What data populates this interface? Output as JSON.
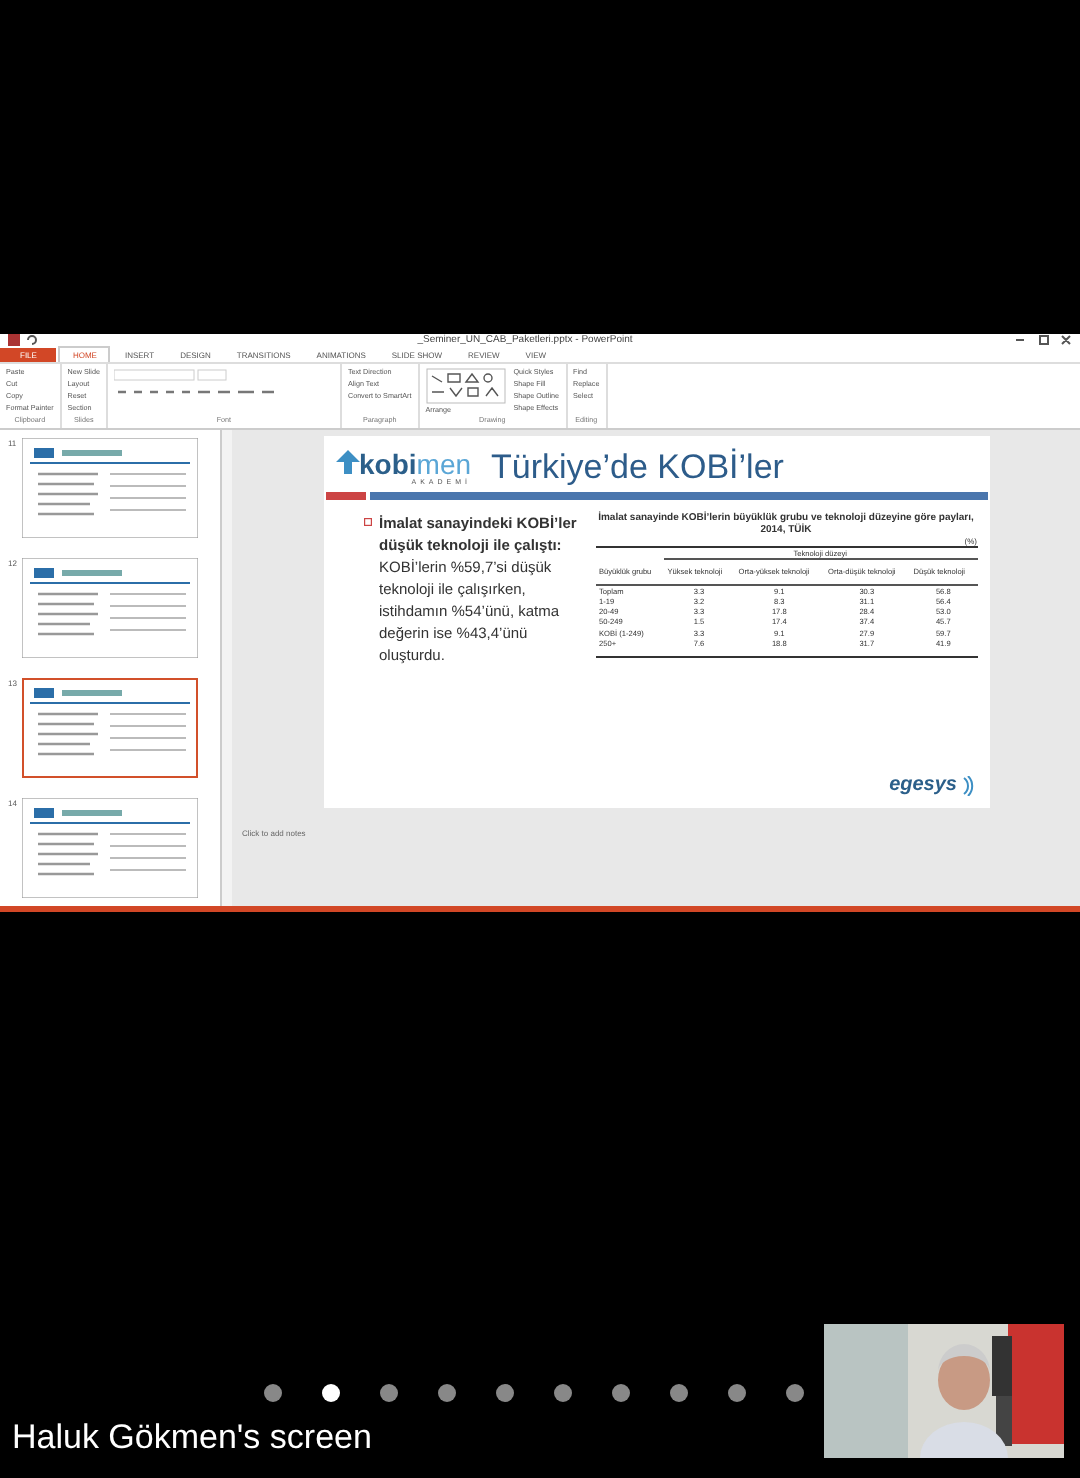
{
  "powerpoint": {
    "title": "_Seminer_UN_CAB_Paketleri.pptx - PowerPoint",
    "ribbon_tabs": [
      {
        "label": "FILE",
        "selected": false,
        "kind": "file"
      },
      {
        "label": "HOME",
        "selected": true,
        "kind": "tab"
      },
      {
        "label": "INSERT",
        "selected": false,
        "kind": "tab"
      },
      {
        "label": "DESIGN",
        "selected": false,
        "kind": "tab"
      },
      {
        "label": "TRANSITIONS",
        "selected": false,
        "kind": "tab"
      },
      {
        "label": "ANIMATIONS",
        "selected": false,
        "kind": "tab"
      },
      {
        "label": "SLIDE SHOW",
        "selected": false,
        "kind": "tab"
      },
      {
        "label": "REVIEW",
        "selected": false,
        "kind": "tab"
      },
      {
        "label": "VIEW",
        "selected": false,
        "kind": "tab"
      }
    ],
    "ribbon_groups": [
      {
        "label": "Clipboard",
        "buttons": [
          "Paste",
          "Cut",
          "Copy",
          "Format Painter"
        ]
      },
      {
        "label": "Slides",
        "buttons": [
          "New Slide",
          "Layout",
          "Reset",
          "Section"
        ]
      },
      {
        "label": "Font"
      },
      {
        "label": "Paragraph",
        "buttons": [
          "Text Direction",
          "Align Text",
          "Convert to SmartArt"
        ]
      },
      {
        "label": "Drawing",
        "buttons": [
          "Arrange",
          "Quick Styles",
          "Shape Fill",
          "Shape Outline",
          "Shape Effects"
        ]
      },
      {
        "label": "Editing",
        "buttons": [
          "Find",
          "Replace",
          "Select"
        ]
      }
    ],
    "thumbnails": [
      {
        "number": "11",
        "selected": false
      },
      {
        "number": "12",
        "selected": false
      },
      {
        "number": "13",
        "selected": true
      },
      {
        "number": "14",
        "selected": false
      }
    ],
    "slide": {
      "logo_main": "kobi",
      "logo_accent": "men",
      "logo_sub": "AKADEMİ",
      "title": "Türkiye’de KOBİ’ler",
      "bullet": "**İmalat sanayindeki KOBİ’ler düşük teknoloji ile çalıştı:** KOBİ’lerin %59,7’si düşük teknoloji ile çalışırken, istihdamın %54’ünü, katma değerin ise %43,4’ünü oluşturdu.",
      "table_title": "İmalat sanayinde KOBİ’lerin büyüklük grubu ve teknoloji düzeyine göre payları, 2014, TÜİK",
      "unit": "(%)",
      "group_header": "Teknoloji düzeyi",
      "columns": [
        "Büyüklük grubu",
        "Yüksek teknoloji",
        "Orta-yüksek teknoloji",
        "Orta-düşük teknoloji",
        "Düşük teknoloji"
      ],
      "rows": [
        [
          "Toplam",
          "3.3",
          "9.1",
          "30.3",
          "56.8"
        ],
        [
          "1-19",
          "3.2",
          "8.3",
          "31.1",
          "56.4"
        ],
        [
          "20-49",
          "3.3",
          "17.8",
          "28.4",
          "53.0"
        ],
        [
          "50-249",
          "1.5",
          "17.4",
          "37.4",
          "45.7"
        ],
        [
          "KOBİ (1-249)",
          "3.3",
          "9.1",
          "27.9",
          "59.7"
        ],
        [
          "250+",
          "7.6",
          "18.8",
          "31.7",
          "41.9"
        ]
      ],
      "footer_logo": "egesys"
    },
    "notes_placeholder": "Click to add notes"
  },
  "call": {
    "pages": [
      {
        "selected": false
      },
      {
        "selected": true
      },
      {
        "selected": false
      },
      {
        "selected": false
      },
      {
        "selected": false
      },
      {
        "selected": false
      },
      {
        "selected": false
      },
      {
        "selected": false
      },
      {
        "selected": false
      },
      {
        "selected": false
      }
    ],
    "screen_label": "Haluk Gökmen's screen"
  }
}
